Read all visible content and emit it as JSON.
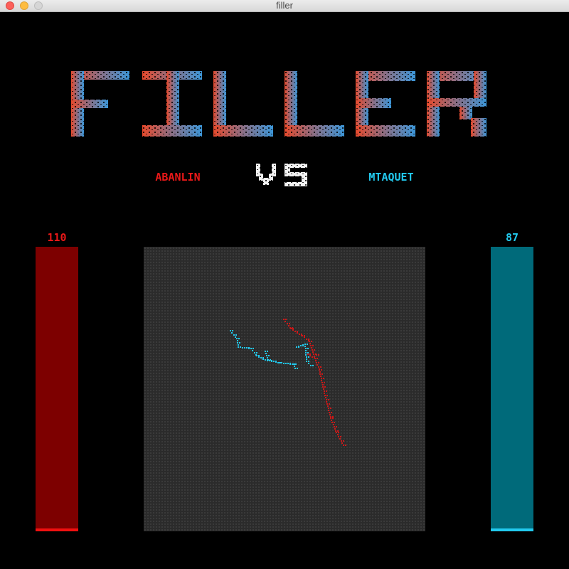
{
  "window": {
    "title": "filler"
  },
  "logo": {
    "text": "FILLER",
    "color_start": "#e84a2c",
    "color_end": "#3c96d8"
  },
  "vs_text": "VS",
  "players": [
    {
      "name": "ABANLIN",
      "score": "110",
      "color": "#e81818",
      "bar_color": "#7d0000"
    },
    {
      "name": "MTAQUET",
      "score": "87",
      "color": "#22c9ee",
      "bar_color": "#006a7a"
    }
  ]
}
